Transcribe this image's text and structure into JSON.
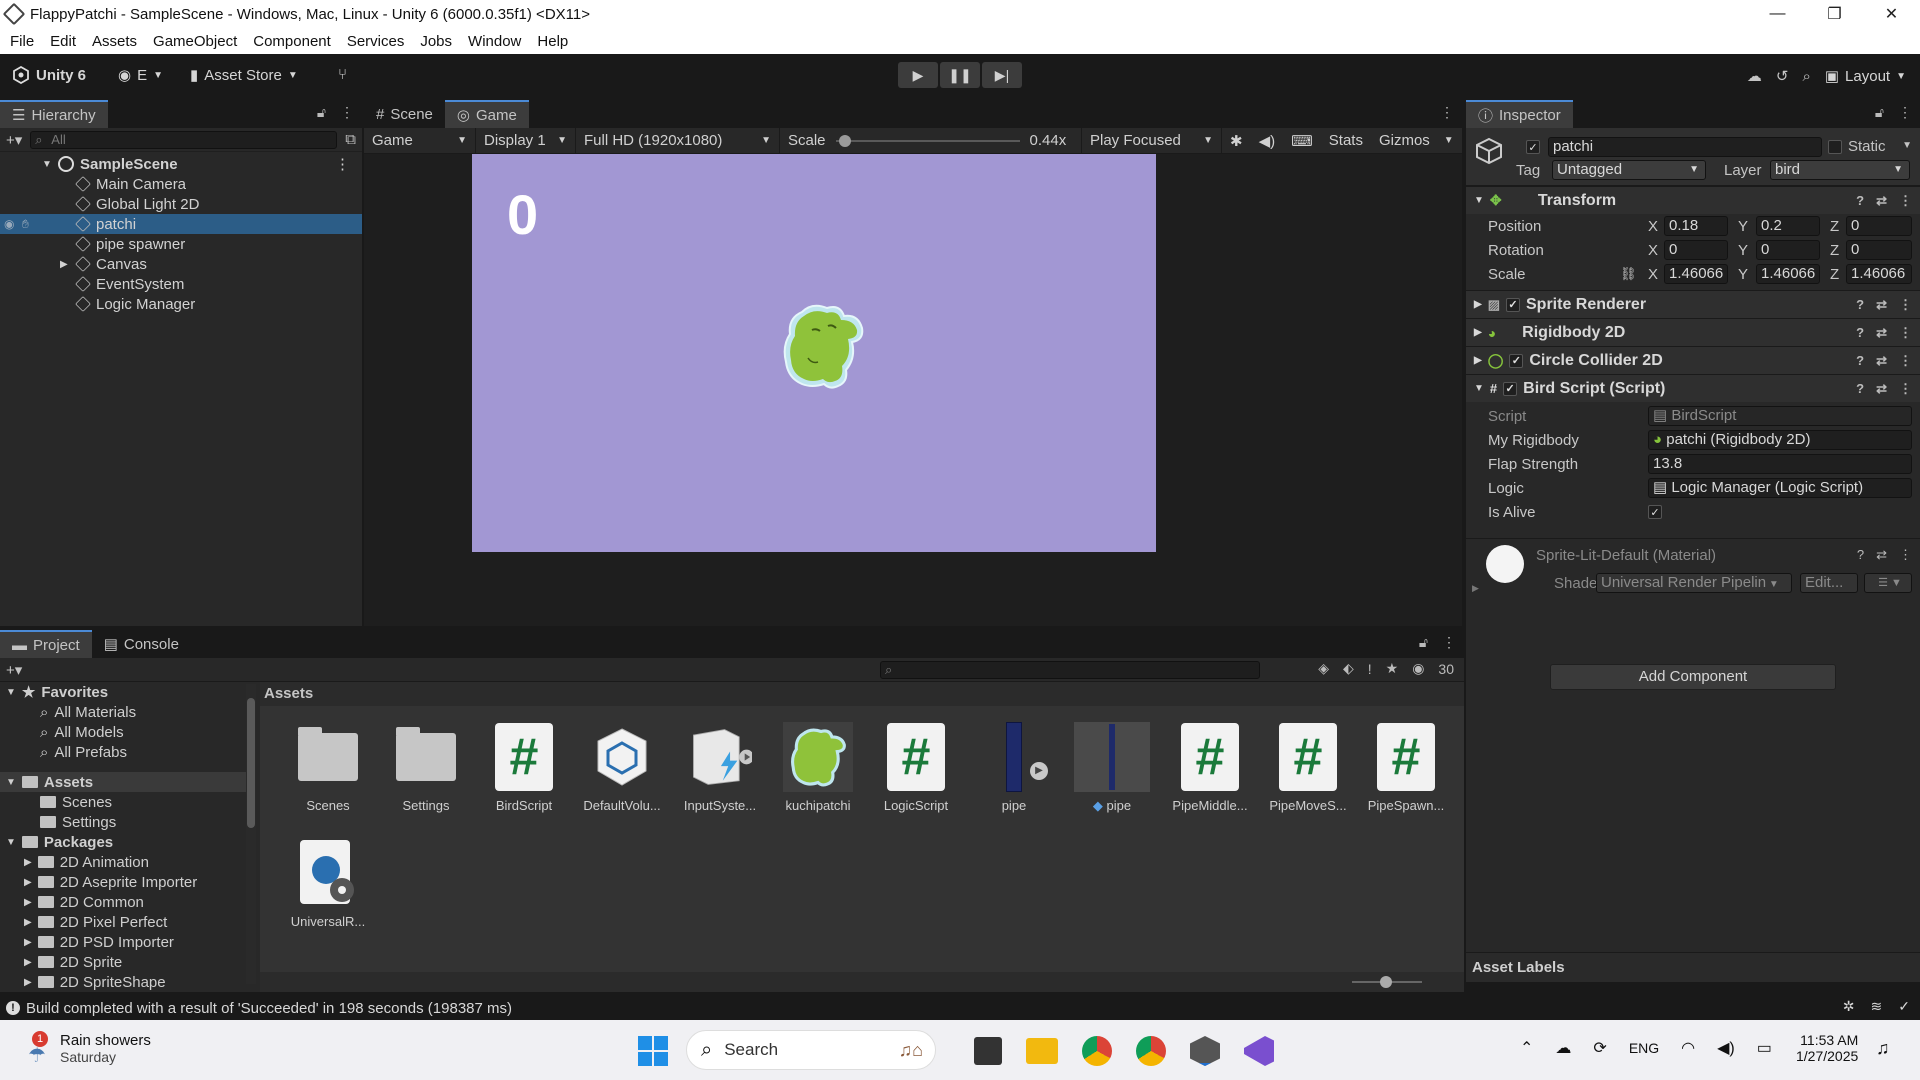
{
  "window": {
    "title": "FlappyPatchi - SampleScene - Windows, Mac, Linux - Unity 6 (6000.0.35f1) <DX11>",
    "minimize": "—",
    "maximize": "❐",
    "close": "✕"
  },
  "menu": [
    "File",
    "Edit",
    "Assets",
    "GameObject",
    "Component",
    "Services",
    "Jobs",
    "Window",
    "Help"
  ],
  "toolbar": {
    "unity_label": "Unity 6",
    "account_label": "E",
    "asset_store": "Asset Store",
    "layout": "Layout"
  },
  "hierarchy": {
    "tab": "Hierarchy",
    "search_placeholder": "All",
    "scene": "SampleScene",
    "items": [
      "Main Camera",
      "Global Light 2D",
      "patchi",
      "pipe spawner",
      "Canvas",
      "EventSystem",
      "Logic Manager"
    ]
  },
  "scene_tabs": {
    "scene": "Scene",
    "game": "Game"
  },
  "game_toolbar": {
    "mode": "Game",
    "display": "Display 1",
    "resolution": "Full HD (1920x1080)",
    "scale_label": "Scale",
    "scale_value": "0.44x",
    "scale_fraction": 0.02,
    "play_mode": "Play Focused",
    "stats": "Stats",
    "gizmos": "Gizmos"
  },
  "game": {
    "score": "0",
    "background": "#a297d3"
  },
  "inspector": {
    "tab": "Inspector",
    "object_name": "patchi",
    "static_label": "Static",
    "tag_label": "Tag",
    "tag_value": "Untagged",
    "layer_label": "Layer",
    "layer_value": "bird",
    "transform": {
      "title": "Transform",
      "position_label": "Position",
      "rotation_label": "Rotation",
      "scale_label": "Scale",
      "position": {
        "x": "0.18",
        "y": "0.2",
        "z": "0"
      },
      "rotation": {
        "x": "0",
        "y": "0",
        "z": "0"
      },
      "scale": {
        "x": "1.46066",
        "y": "1.46066",
        "z": "1.46066"
      }
    },
    "components": [
      "Sprite Renderer",
      "Rigidbody 2D",
      "Circle Collider 2D",
      "Bird Script (Script)"
    ],
    "bird_script": {
      "script_label": "Script",
      "script_value": "BirdScript",
      "rigidbody_label": "My Rigidbody",
      "rigidbody_value": "patchi (Rigidbody 2D)",
      "flap_label": "Flap Strength",
      "flap_value": "13.8",
      "logic_label": "Logic",
      "logic_value": "Logic Manager (Logic Script)",
      "alive_label": "Is Alive"
    },
    "material": {
      "name": "Sprite-Lit-Default (Material)",
      "shader_label": "Shader",
      "shader_value": "Universal Render Pipelin",
      "edit": "Edit..."
    },
    "add_component": "Add Component",
    "asset_labels": "Asset Labels"
  },
  "project": {
    "tab_project": "Project",
    "tab_console": "Console",
    "count": "30",
    "favorites": "Favorites",
    "fav_items": [
      "All Materials",
      "All Models",
      "All Prefabs"
    ],
    "assets_root": "Assets",
    "asset_folders": [
      "Scenes",
      "Settings"
    ],
    "packages_root": "Packages",
    "packages": [
      "2D Animation",
      "2D Aseprite Importer",
      "2D Common",
      "2D Pixel Perfect",
      "2D PSD Importer",
      "2D Sprite",
      "2D SpriteShape"
    ],
    "breadcrumb": "Assets",
    "assets": [
      "Scenes",
      "Settings",
      "BirdScript",
      "DefaultVolu...",
      "InputSyste...",
      "kuchipatchi",
      "LogicScript",
      "pipe",
      "pipe",
      "PipeMiddle...",
      "PipeMoveS...",
      "PipeSpawn...",
      "UniversalR..."
    ]
  },
  "status": {
    "message": "Build completed with a result of 'Succeeded' in 198 seconds (198387 ms)"
  },
  "taskbar": {
    "weather_title": "Rain showers",
    "weather_sub": "Saturday",
    "weather_badge": "1",
    "search": "Search",
    "lang": "ENG",
    "time": "11:53 AM",
    "date": "1/27/2025"
  }
}
